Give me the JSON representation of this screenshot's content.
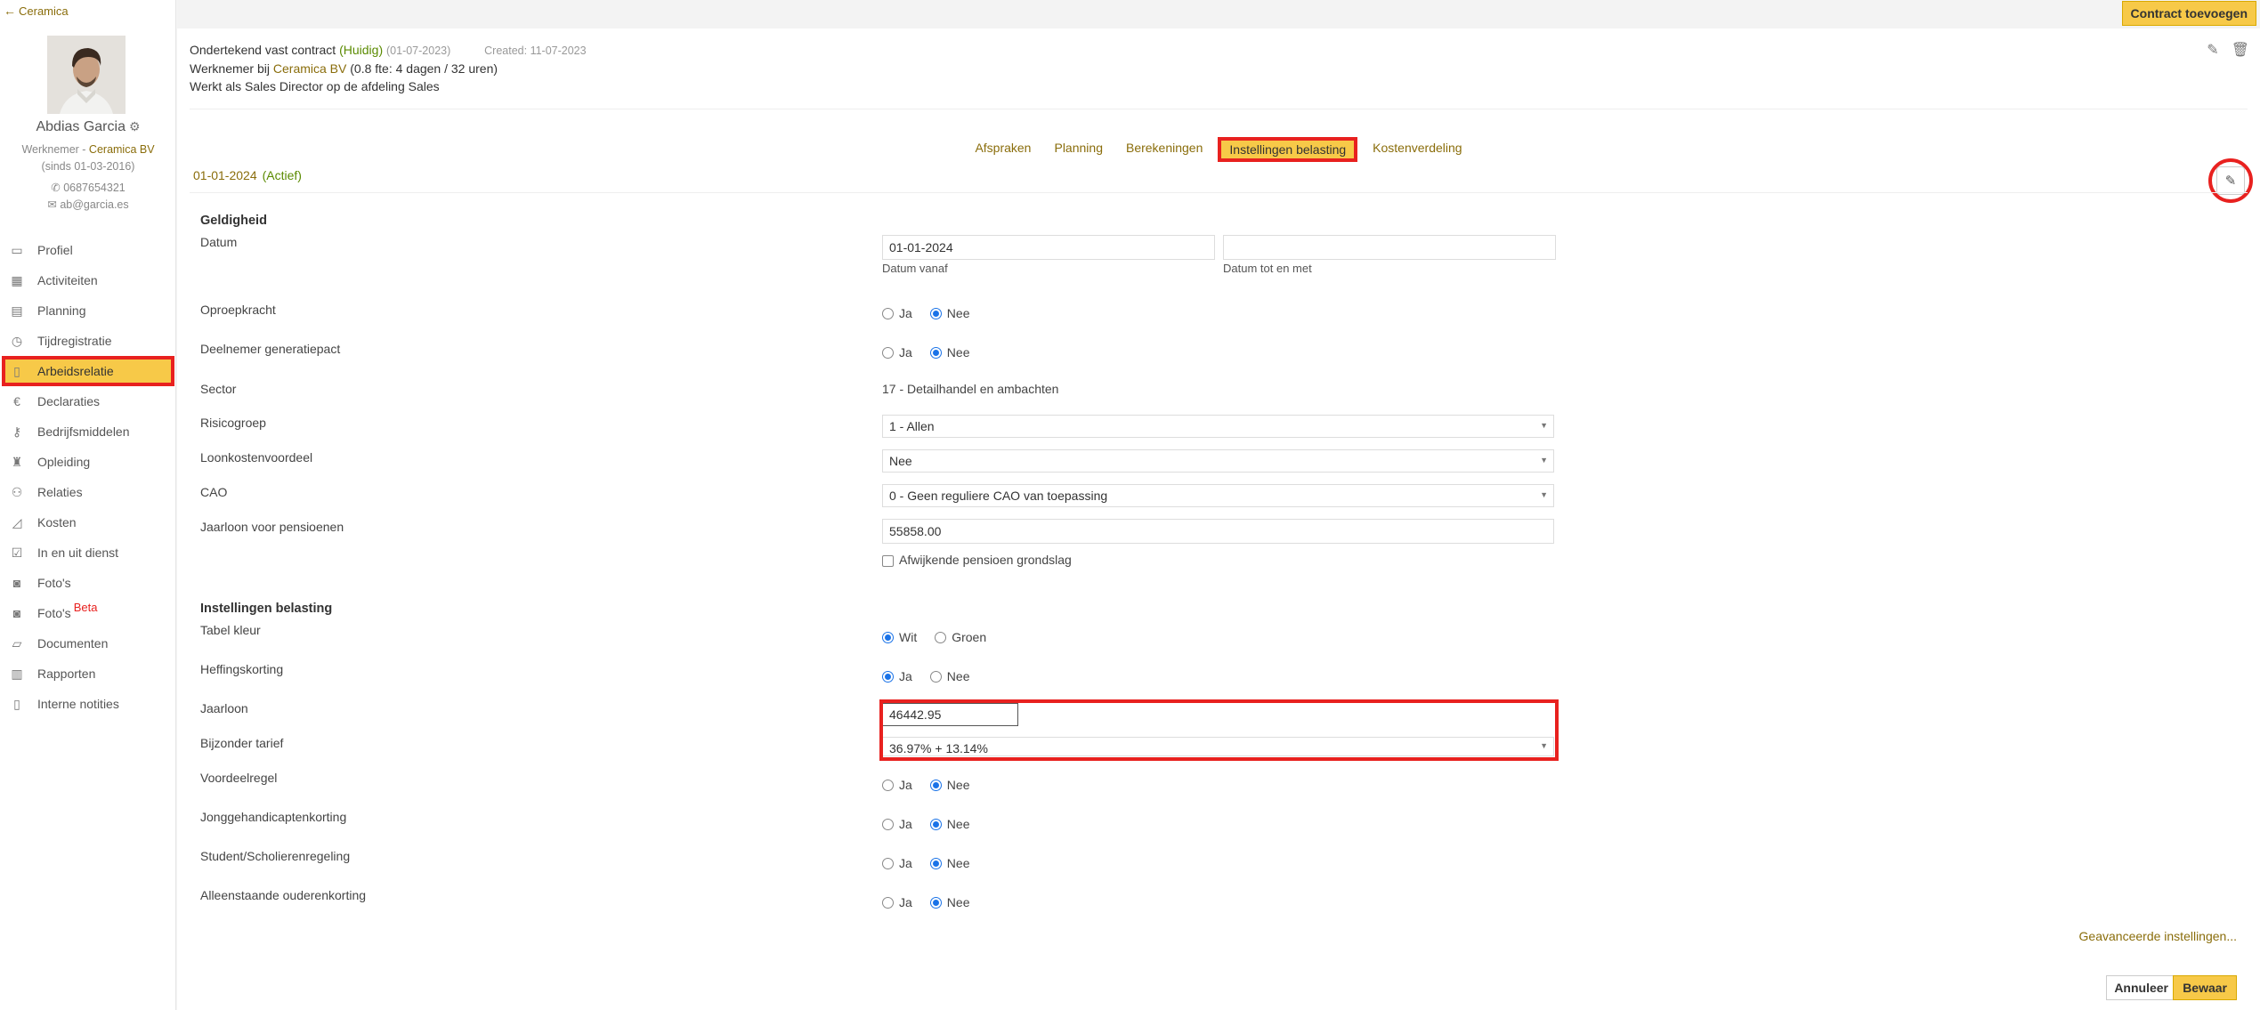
{
  "back_link": "Ceramica",
  "profile": {
    "name": "Abdias Garcia",
    "role_prefix": "Werknemer - ",
    "company": "Ceramica BV",
    "since": "(sinds 01-03-2016)",
    "phone": "0687654321",
    "email": "ab@garcia.es"
  },
  "nav": [
    {
      "label": "Profiel",
      "icon": "id-card-icon"
    },
    {
      "label": "Activiteiten",
      "icon": "table-icon"
    },
    {
      "label": "Planning",
      "icon": "calendar-icon"
    },
    {
      "label": "Tijdregistratie",
      "icon": "stopwatch-icon"
    },
    {
      "label": "Arbeidsrelatie",
      "icon": "contract-icon",
      "active": true
    },
    {
      "label": "Declaraties",
      "icon": "euro-icon"
    },
    {
      "label": "Bedrijfsmiddelen",
      "icon": "key-icon"
    },
    {
      "label": "Opleiding",
      "icon": "training-icon"
    },
    {
      "label": "Relaties",
      "icon": "people-icon"
    },
    {
      "label": "Kosten",
      "icon": "chart-icon"
    },
    {
      "label": "In en uit dienst",
      "icon": "user-check-icon"
    },
    {
      "label": "Foto's",
      "icon": "camera-icon"
    },
    {
      "label": "Foto's",
      "icon": "camera-icon",
      "badge": "Beta"
    },
    {
      "label": "Documenten",
      "icon": "folder-icon"
    },
    {
      "label": "Rapporten",
      "icon": "report-icon"
    },
    {
      "label": "Interne notities",
      "icon": "clipboard-icon"
    }
  ],
  "topbar": {
    "add_contract": "Contract toevoegen"
  },
  "contract": {
    "title": "Ondertekend vast contract",
    "status": "(Huidig)",
    "date": "(01-07-2023)",
    "created": "Created: 11-07-2023",
    "employer_prefix": "Werknemer bij ",
    "employer": "Ceramica BV",
    "fte": " (0.8 fte: 4 dagen / 32 uren)",
    "function": "Werkt als Sales Director op de afdeling Sales"
  },
  "tabs": [
    {
      "label": "Afspraken"
    },
    {
      "label": "Planning"
    },
    {
      "label": "Berekeningen"
    },
    {
      "label": "Instellingen belasting",
      "active": true
    },
    {
      "label": "Kostenverdeling"
    }
  ],
  "period": {
    "date": "01-01-2024",
    "status": "(Actief)"
  },
  "form": {
    "geldigheid_title": "Geldigheid",
    "datum_label": "Datum",
    "datum_van_value": "01-01-2024",
    "datum_van_sub": "Datum vanaf",
    "datum_tot_value": "",
    "datum_tot_sub": "Datum tot en met",
    "oproepkracht_label": "Oproepkracht",
    "deelnemer_label": "Deelnemer generatiepact",
    "sector_label": "Sector",
    "sector_value": "17 - Detailhandel en ambachten",
    "risicogroep_label": "Risicogroep",
    "risicogroep_value": "1 - Allen",
    "loonkosten_label": "Loonkostenvoordeel",
    "loonkosten_value": "Nee",
    "cao_label": "CAO",
    "cao_value": "0 - Geen reguliere CAO van toepassing",
    "jaarloon_pensioen_label": "Jaarloon voor pensioenen",
    "jaarloon_pensioen_value": "55858.00",
    "afwijkende_label": "Afwijkende pensioen grondslag",
    "belasting_title": "Instellingen belasting",
    "tabel_kleur_label": "Tabel kleur",
    "wit": "Wit",
    "groen": "Groen",
    "heffingskorting_label": "Heffingskorting",
    "jaarloon_label": "Jaarloon",
    "jaarloon_value": "46442.95",
    "bijzonder_label": "Bijzonder tarief",
    "bijzonder_value": "36.97% + 13.14%",
    "voordeelregel_label": "Voordeelregel",
    "jonggehandicapten_label": "Jonggehandicaptenkorting",
    "student_label": "Student/Scholierenregeling",
    "alleenstaande_label": "Alleenstaande ouderenkorting",
    "ja": "Ja",
    "nee": "Nee"
  },
  "advanced_link": "Geavanceerde instellingen...",
  "buttons": {
    "cancel": "Annuleer",
    "save": "Bewaar"
  },
  "colors": {
    "accent": "#f7c948",
    "link": "#8a6d0b",
    "highlight": "#e8211f",
    "active_green": "#5a8a00"
  }
}
